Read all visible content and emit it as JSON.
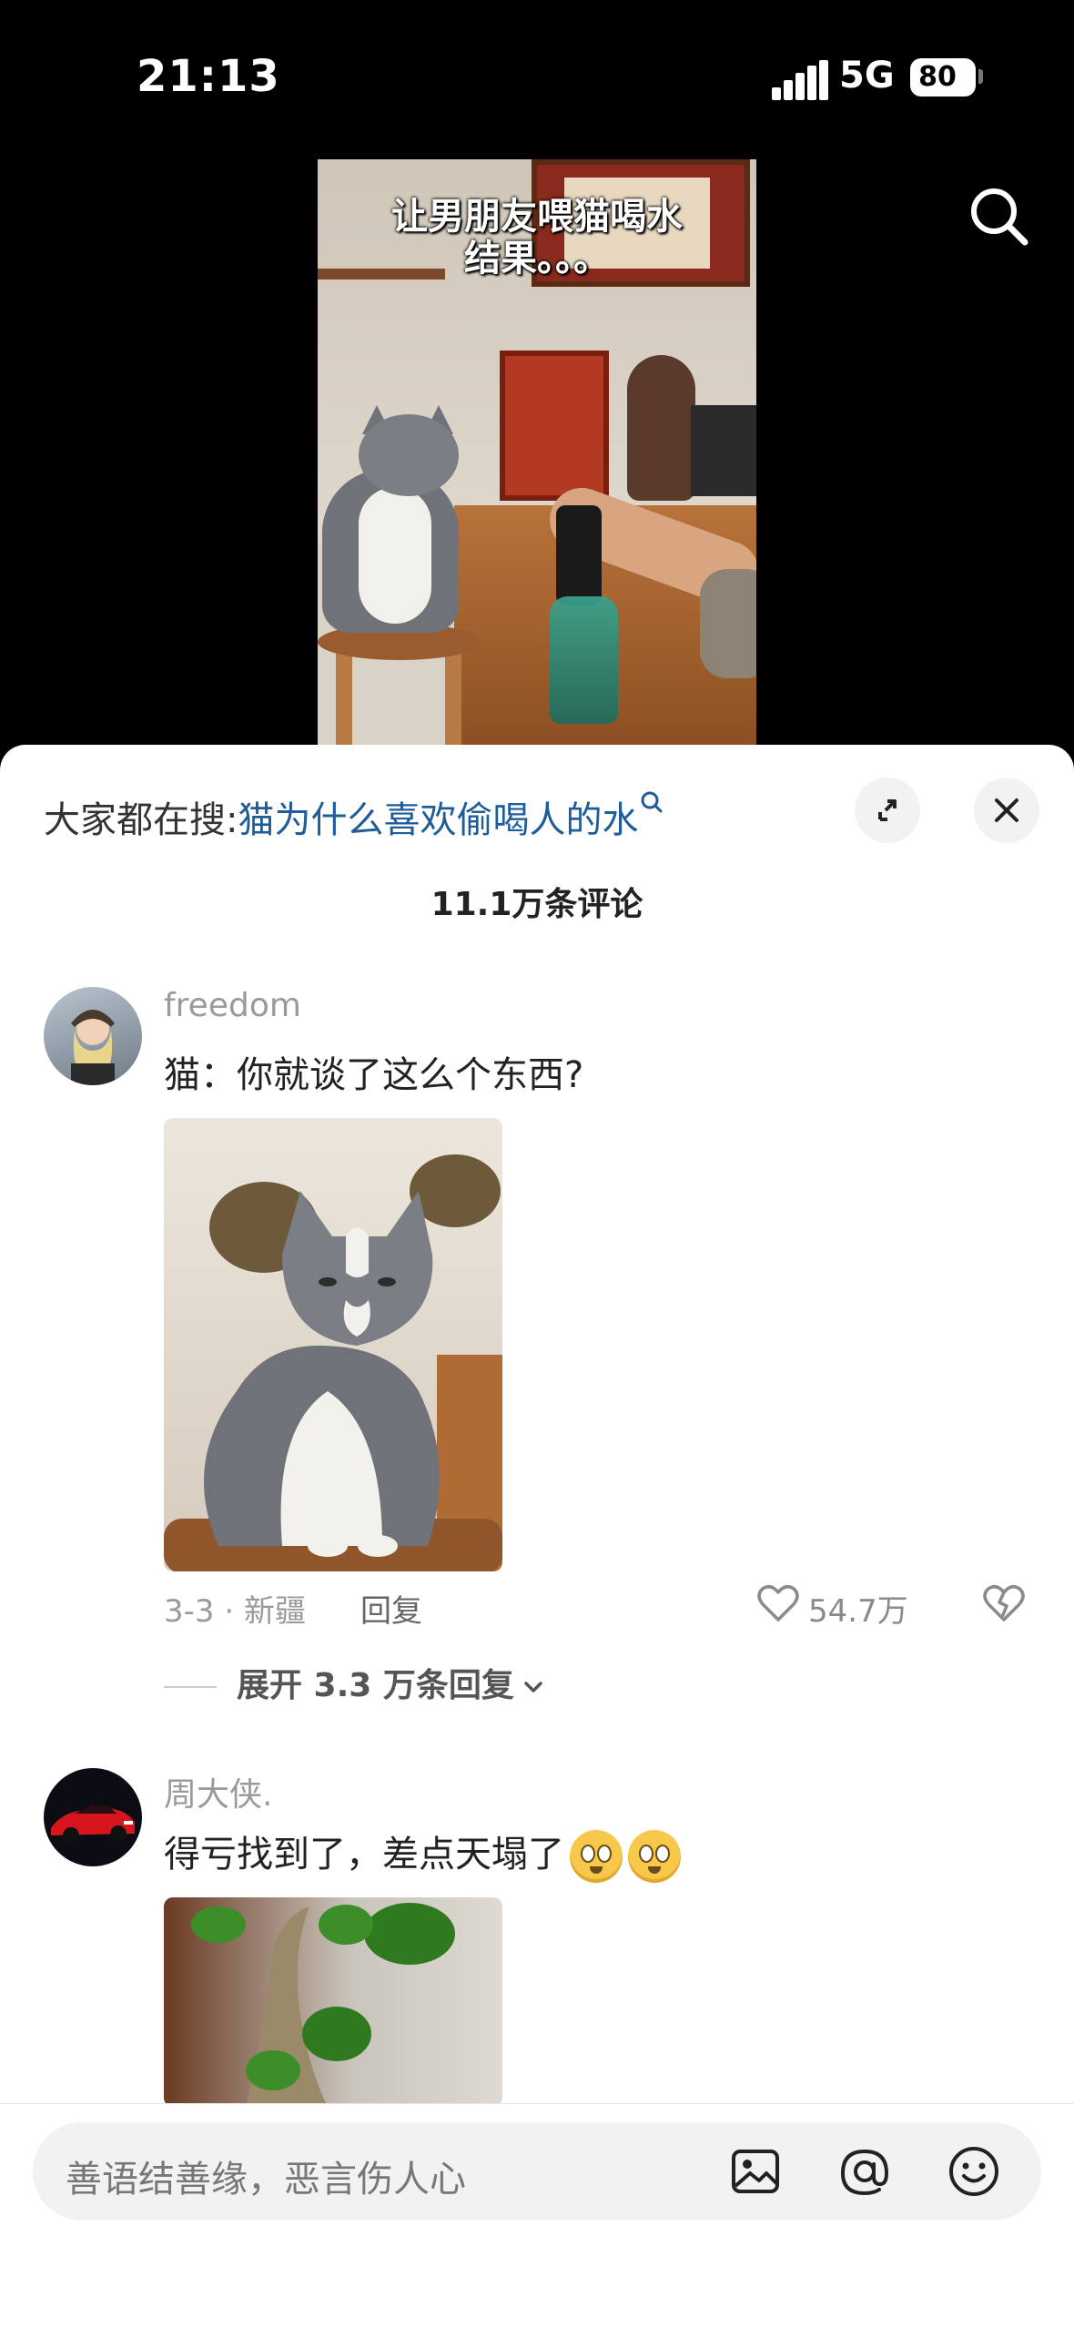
{
  "status": {
    "time": "21:13",
    "network": "5G",
    "battery": "80"
  },
  "video": {
    "caption_line1": "让男朋友喂猫喝水",
    "caption_line2": "结果。。。"
  },
  "sheet": {
    "trend_label": "大家都在搜:",
    "trend_query": "猫为什么喜欢偷喝人的水",
    "comment_count": "11.1万条评论"
  },
  "comments": [
    {
      "username": "freedom",
      "text": "猫：你就谈了这么个东西?",
      "meta": "3-3 · 新疆",
      "reply_label": "回复",
      "likes": "54.7万",
      "expand_label": "展开 3.3 万条回复"
    },
    {
      "username": "周大侠.",
      "text": "得亏找到了，差点天塌了"
    }
  ],
  "input": {
    "placeholder": "善语结善缘，恶言伤人心"
  },
  "icons": {
    "search": "search-icon",
    "expand": "expand-icon",
    "close": "close-icon",
    "like": "heart-icon",
    "dislike": "broken-heart-icon",
    "image": "image-icon",
    "mention": "at-icon",
    "emoji": "smile-icon"
  }
}
